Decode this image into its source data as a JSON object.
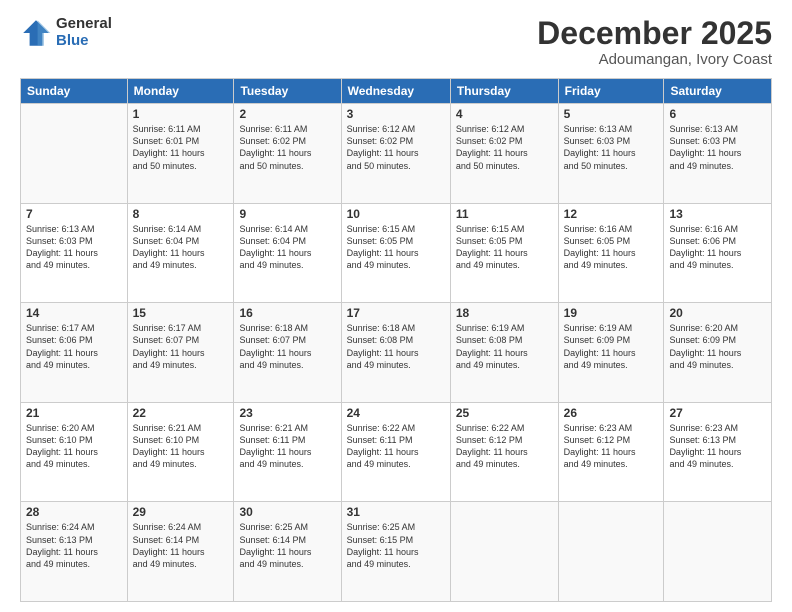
{
  "logo": {
    "general": "General",
    "blue": "Blue"
  },
  "header": {
    "month": "December 2025",
    "location": "Adoumangan, Ivory Coast"
  },
  "weekdays": [
    "Sunday",
    "Monday",
    "Tuesday",
    "Wednesday",
    "Thursday",
    "Friday",
    "Saturday"
  ],
  "weeks": [
    [
      {
        "day": "",
        "empty": true
      },
      {
        "day": "1",
        "sunrise": "6:11 AM",
        "sunset": "6:01 PM",
        "daylight": "11 hours and 50 minutes."
      },
      {
        "day": "2",
        "sunrise": "6:11 AM",
        "sunset": "6:02 PM",
        "daylight": "11 hours and 50 minutes."
      },
      {
        "day": "3",
        "sunrise": "6:12 AM",
        "sunset": "6:02 PM",
        "daylight": "11 hours and 50 minutes."
      },
      {
        "day": "4",
        "sunrise": "6:12 AM",
        "sunset": "6:02 PM",
        "daylight": "11 hours and 50 minutes."
      },
      {
        "day": "5",
        "sunrise": "6:13 AM",
        "sunset": "6:03 PM",
        "daylight": "11 hours and 50 minutes."
      },
      {
        "day": "6",
        "sunrise": "6:13 AM",
        "sunset": "6:03 PM",
        "daylight": "11 hours and 49 minutes."
      }
    ],
    [
      {
        "day": "7",
        "sunrise": "6:13 AM",
        "sunset": "6:03 PM",
        "daylight": "11 hours and 49 minutes."
      },
      {
        "day": "8",
        "sunrise": "6:14 AM",
        "sunset": "6:04 PM",
        "daylight": "11 hours and 49 minutes."
      },
      {
        "day": "9",
        "sunrise": "6:14 AM",
        "sunset": "6:04 PM",
        "daylight": "11 hours and 49 minutes."
      },
      {
        "day": "10",
        "sunrise": "6:15 AM",
        "sunset": "6:05 PM",
        "daylight": "11 hours and 49 minutes."
      },
      {
        "day": "11",
        "sunrise": "6:15 AM",
        "sunset": "6:05 PM",
        "daylight": "11 hours and 49 minutes."
      },
      {
        "day": "12",
        "sunrise": "6:16 AM",
        "sunset": "6:05 PM",
        "daylight": "11 hours and 49 minutes."
      },
      {
        "day": "13",
        "sunrise": "6:16 AM",
        "sunset": "6:06 PM",
        "daylight": "11 hours and 49 minutes."
      }
    ],
    [
      {
        "day": "14",
        "sunrise": "6:17 AM",
        "sunset": "6:06 PM",
        "daylight": "11 hours and 49 minutes."
      },
      {
        "day": "15",
        "sunrise": "6:17 AM",
        "sunset": "6:07 PM",
        "daylight": "11 hours and 49 minutes."
      },
      {
        "day": "16",
        "sunrise": "6:18 AM",
        "sunset": "6:07 PM",
        "daylight": "11 hours and 49 minutes."
      },
      {
        "day": "17",
        "sunrise": "6:18 AM",
        "sunset": "6:08 PM",
        "daylight": "11 hours and 49 minutes."
      },
      {
        "day": "18",
        "sunrise": "6:19 AM",
        "sunset": "6:08 PM",
        "daylight": "11 hours and 49 minutes."
      },
      {
        "day": "19",
        "sunrise": "6:19 AM",
        "sunset": "6:09 PM",
        "daylight": "11 hours and 49 minutes."
      },
      {
        "day": "20",
        "sunrise": "6:20 AM",
        "sunset": "6:09 PM",
        "daylight": "11 hours and 49 minutes."
      }
    ],
    [
      {
        "day": "21",
        "sunrise": "6:20 AM",
        "sunset": "6:10 PM",
        "daylight": "11 hours and 49 minutes."
      },
      {
        "day": "22",
        "sunrise": "6:21 AM",
        "sunset": "6:10 PM",
        "daylight": "11 hours and 49 minutes."
      },
      {
        "day": "23",
        "sunrise": "6:21 AM",
        "sunset": "6:11 PM",
        "daylight": "11 hours and 49 minutes."
      },
      {
        "day": "24",
        "sunrise": "6:22 AM",
        "sunset": "6:11 PM",
        "daylight": "11 hours and 49 minutes."
      },
      {
        "day": "25",
        "sunrise": "6:22 AM",
        "sunset": "6:12 PM",
        "daylight": "11 hours and 49 minutes."
      },
      {
        "day": "26",
        "sunrise": "6:23 AM",
        "sunset": "6:12 PM",
        "daylight": "11 hours and 49 minutes."
      },
      {
        "day": "27",
        "sunrise": "6:23 AM",
        "sunset": "6:13 PM",
        "daylight": "11 hours and 49 minutes."
      }
    ],
    [
      {
        "day": "28",
        "sunrise": "6:24 AM",
        "sunset": "6:13 PM",
        "daylight": "11 hours and 49 minutes."
      },
      {
        "day": "29",
        "sunrise": "6:24 AM",
        "sunset": "6:14 PM",
        "daylight": "11 hours and 49 minutes."
      },
      {
        "day": "30",
        "sunrise": "6:25 AM",
        "sunset": "6:14 PM",
        "daylight": "11 hours and 49 minutes."
      },
      {
        "day": "31",
        "sunrise": "6:25 AM",
        "sunset": "6:15 PM",
        "daylight": "11 hours and 49 minutes."
      },
      {
        "day": "",
        "empty": true
      },
      {
        "day": "",
        "empty": true
      },
      {
        "day": "",
        "empty": true
      }
    ]
  ],
  "labels": {
    "sunrise": "Sunrise: ",
    "sunset": "Sunset: ",
    "daylight": "Daylight: "
  }
}
